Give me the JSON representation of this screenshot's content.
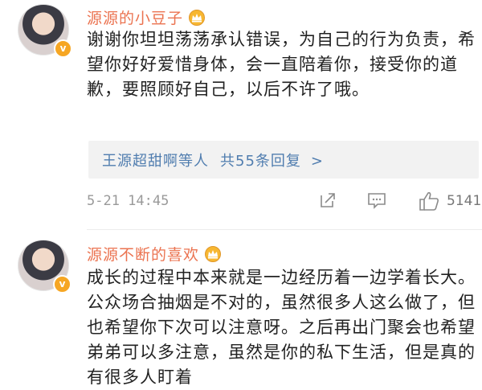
{
  "comments": [
    {
      "username": "源源的小豆子",
      "text": "谢谢你坦坦荡荡承认错误，为自己的行为负责，希望你好好爱惜身体，会一直陪着你，接受你的道歉，要照顾好自己，以后不许了哦。",
      "reply_summary": "王源超甜啊等人",
      "reply_count": "共55条回复",
      "reply_arrow": ">",
      "timestamp": "5-21 14:45",
      "likes": "5141",
      "avatar_icon": "user-avatar",
      "badge_icon": "verified-badge-icon",
      "vip_icon": "crown-icon"
    },
    {
      "username": "源源不断的喜欢",
      "text": "成长的过程中本来就是一边经历着一边学着长大。公众场合抽烟是不对的，虽然很多人这么做了，但也希望你下次可以注意呀。之后再出门聚会也希望弟弟可以多注意，虽然是你的私下生活，但是真的有很多人盯着",
      "avatar_icon": "user-avatar",
      "badge_icon": "verified-badge-icon",
      "vip_icon": "crown-icon"
    }
  ],
  "colors": {
    "username": "#eb7350",
    "link": "#507daf",
    "meta": "#9a9a9a",
    "reply_bg": "#f2f2f2",
    "badge": "#f6a623"
  }
}
